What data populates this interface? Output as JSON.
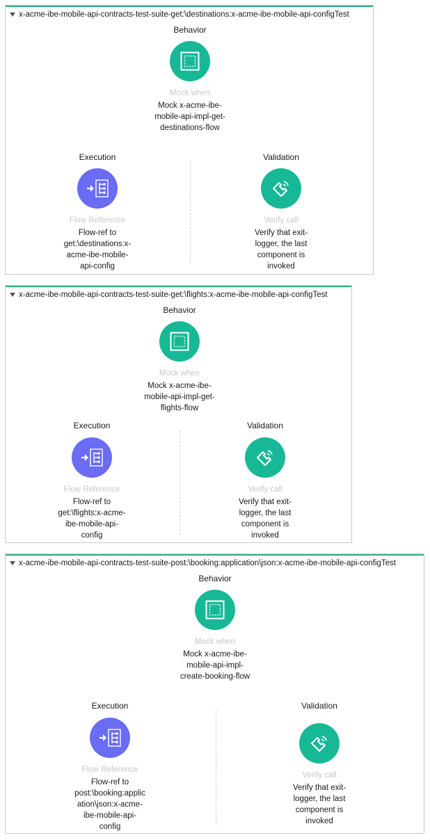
{
  "labels": {
    "behavior": "Behavior",
    "execution": "Execution",
    "validation": "Validation"
  },
  "component_types": {
    "mock_when": "Mock when",
    "flow_reference": "Flow Reference",
    "verify_call": "Verify call"
  },
  "suites": [
    {
      "title": "x-acme-ibe-mobile-api-contracts-test-suite-get:\\destinations:x-acme-ibe-mobile-api-configTest",
      "behavior_desc": "Mock x-acme-ibe-mobile-api-impl-get-destinations-flow",
      "execution_desc": "Flow-ref to get:\\destinations:x-acme-ibe-mobile-api-config",
      "validation_desc": "Verify that exit-logger, the last component is invoked"
    },
    {
      "title": "x-acme-ibe-mobile-api-contracts-test-suite-get:\\flights:x-acme-ibe-mobile-api-configTest",
      "behavior_desc": "Mock x-acme-ibe-mobile-api-impl-get-flights-flow",
      "execution_desc": "Flow-ref to get:\\flights:x-acme-ibe-mobile-api-config",
      "validation_desc": "Verify that exit-logger, the last component is invoked"
    },
    {
      "title": "x-acme-ibe-mobile-api-contracts-test-suite-post:\\booking:application\\json:x-acme-ibe-mobile-api-configTest",
      "behavior_desc": "Mock x-acme-ibe-mobile-api-impl-create-booking-flow",
      "execution_desc": "Flow-ref to post:\\booking:application\\json:x-acme-ibe-mobile-api-config",
      "validation_desc": "Verify that exit-logger, the last component is invoked"
    }
  ]
}
